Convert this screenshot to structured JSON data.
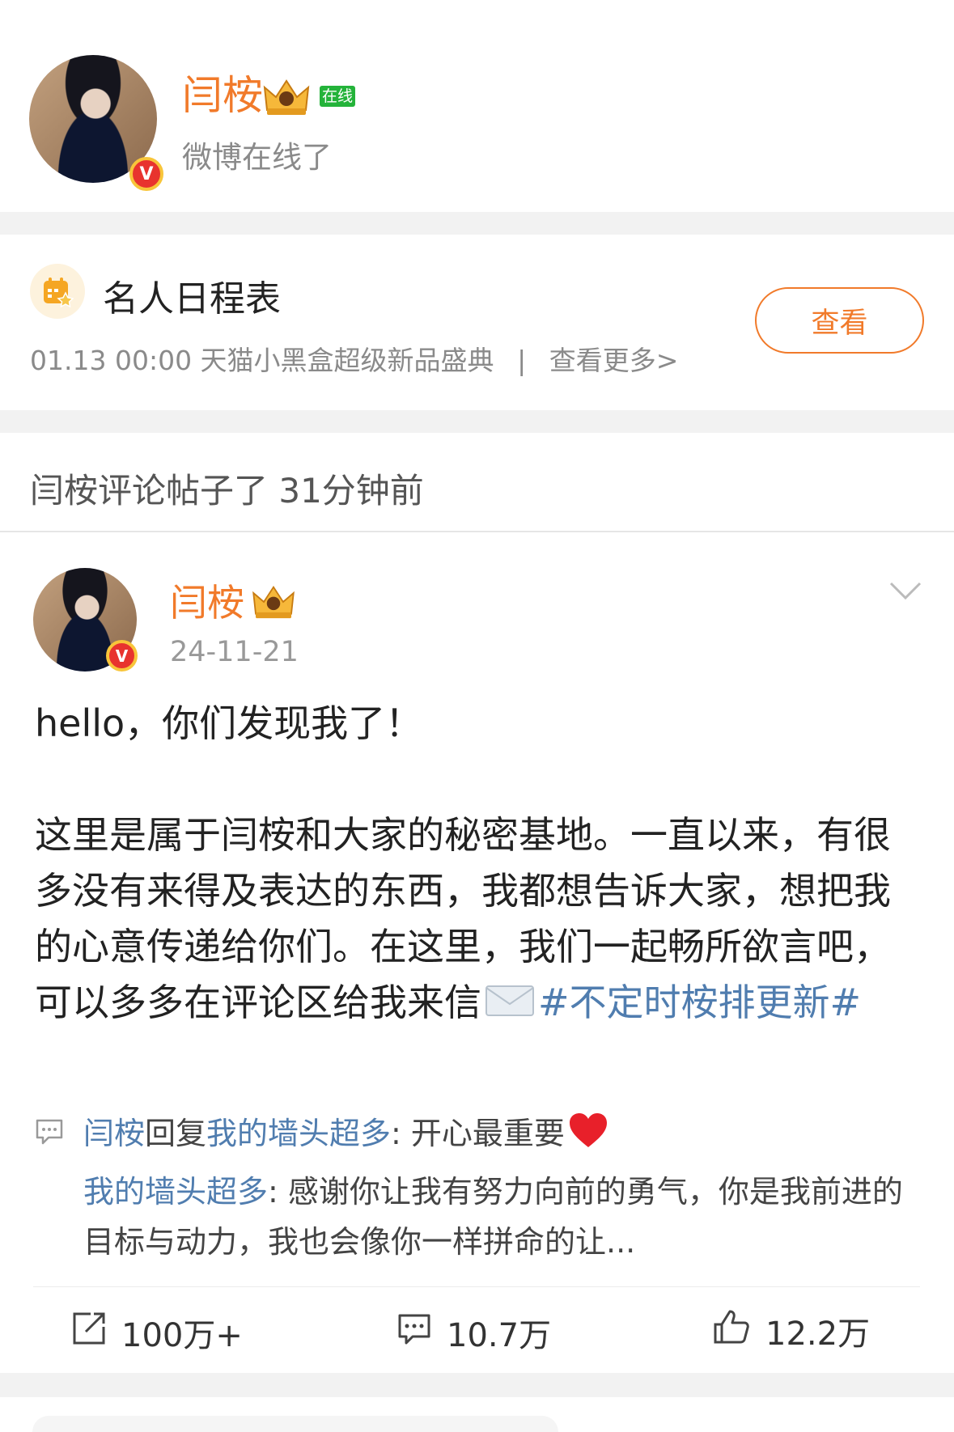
{
  "profile": {
    "name": "闫桉",
    "online_badge": "在线",
    "status": "微博在线了",
    "verified_mark": "V",
    "avatar_icon": "avatar-photo",
    "crown_icon": "crown-icon"
  },
  "schedule": {
    "title": "名人日程表",
    "event": "01.13 00:00 天猫小黑盒超级新品盛典",
    "separator": "|",
    "more": "查看更多>",
    "button": "查看",
    "icon": "calendar-star-icon"
  },
  "activity": {
    "text": "闫桉评论帖子了 31分钟前"
  },
  "post": {
    "author": "闫桉",
    "date": "24-11-21",
    "greeting": "hello，你们发现我了！",
    "body": "这里是属于闫桉和大家的秘密基地。一直以来，有很多没有来得及表达的东西，我都想告诉大家，想把我的心意传递给你们。在这里，我们一起畅所欲言吧，可以多多在评论区给我来信",
    "envelope_icon": "envelope-icon",
    "hashtag": "#不定时桉排更新#"
  },
  "comments": {
    "reply_author": "闫桉",
    "reply_word": "回复",
    "reply_target": "我的墙头超多",
    "reply_text": ": 开心最重要",
    "heart_icon": "heart-icon",
    "commenter": "我的墙头超多",
    "comment_text": ": 感谢你让我有努力向前的勇气，你是我前进的目标与动力，我也会像你一样拼命的让..."
  },
  "actions": {
    "repost_count": "100万+",
    "comment_count": "10.7万",
    "like_count": "12.2万"
  },
  "colors": {
    "name_orange": "#f17a2a",
    "link_blue": "#507daf",
    "online_green": "#24b33a",
    "badge_red": "#e8332e",
    "gap_gray": "#f2f2f2"
  }
}
